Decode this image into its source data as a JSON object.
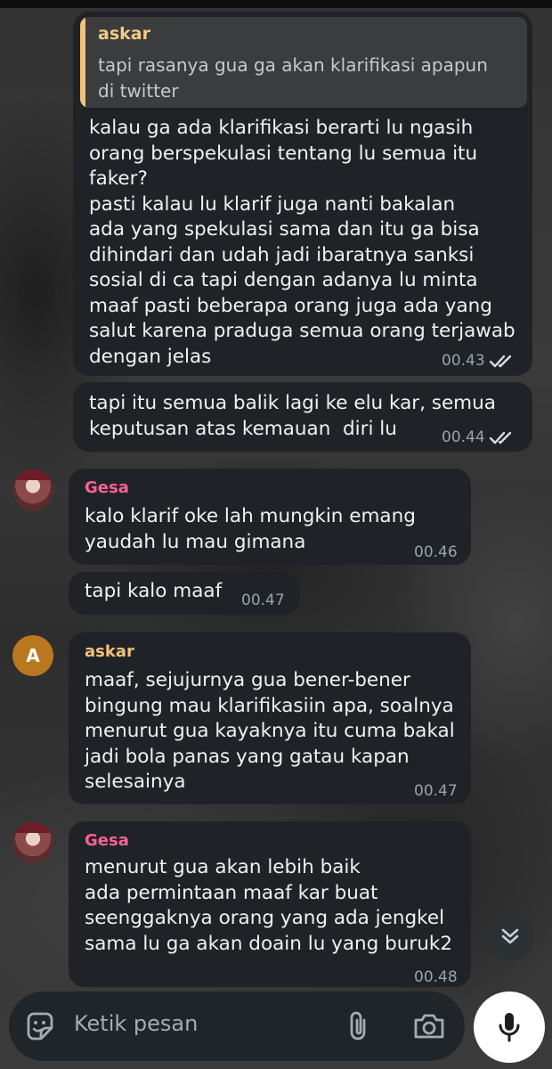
{
  "messages": [
    {
      "id": "m1",
      "reply": {
        "name": "askar",
        "text": "tapi rasanya gua ga akan klarifikasi apapun\ndi twitter"
      },
      "text": "kalau ga ada klarifikasi berarti lu ngasih\norang berspekulasi tentang lu semua itu\nfaker?\npasti kalau lu klarif juga nanti bakalan\nada yang spekulasi sama dan itu ga bisa\ndihindari dan udah jadi ibaratnya sanksi\nsosial di ca tapi dengan adanya lu minta\nmaaf pasti beberapa orang juga ada yang\nsalut karena praduga semua orang terjawab\ndengan jelas",
      "time": "00.43",
      "status": "read"
    },
    {
      "id": "m2",
      "text": "tapi itu semua balik lagi ke elu kar, semua\nkeputusan atas kemauan  diri lu",
      "time": "00.44",
      "status": "read"
    },
    {
      "id": "m3",
      "sender": "Gesa",
      "text": "kalo klarif oke lah mungkin emang\nyaudah lu mau gimana",
      "time": "00.46"
    },
    {
      "id": "m4",
      "text": "tapi kalo maaf",
      "time": "00.47"
    },
    {
      "id": "m5",
      "sender": "askar",
      "avatar_letter": "A",
      "text": "maaf, sejujurnya gua bener-bener\nbingung mau klarifikasiin apa, soalnya\nmenurut gua kayaknya itu cuma bakal\njadi bola panas yang gatau kapan\nselesainya",
      "time": "00.47"
    },
    {
      "id": "m6",
      "sender": "Gesa",
      "text": "menurut gua akan lebih baik\nada permintaan maaf kar buat\nseenggaknya orang yang ada jengkel\nsama lu ga akan doain lu yang buruk2",
      "time": "00.48"
    }
  ],
  "composer": {
    "placeholder": "Ketik pesan",
    "icons": [
      "sticker-icon",
      "attachment-icon",
      "camera-icon",
      "microphone-icon"
    ]
  },
  "colors": {
    "bubble": "#1f2327",
    "gesa_name": "#ff5f95",
    "askar_name": "#f0c27b",
    "avatar_letter_bg": "#b9771f",
    "timestamp": "#9aa3ab"
  }
}
